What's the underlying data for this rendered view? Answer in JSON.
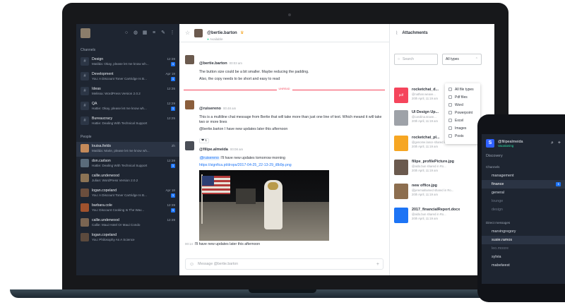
{
  "sidebar": {
    "channels_label": "Channels",
    "people_label": "People",
    "channels": [
      {
        "name": "Design",
        "message": "Matilda: Okay, please let me know wh...",
        "time": "12:39",
        "badge": "1"
      },
      {
        "name": "Development",
        "message": "You: A Discount Toner Cartridge Is B...",
        "time": "Apr 19",
        "badge": "1"
      },
      {
        "name": "Ideas",
        "message": "Melissa: WordPress Version 2.0.2",
        "time": "12:35",
        "badge": ""
      },
      {
        "name": "QA",
        "message": "Hattie: Okay, please let me know wh...",
        "time": "12:29",
        "badge": "1"
      },
      {
        "name": "Bureaucracy",
        "message": "Hattie: Dealing With Technical Support",
        "time": "12:25",
        "badge": ""
      }
    ],
    "people": [
      {
        "name": "louisa.fields",
        "message": "Matilda: Marie, please let me know wh...",
        "time": "2h",
        "badge": "",
        "color": "#c48a5a"
      },
      {
        "name": "don.carlson",
        "message": "Hattie: Dealing With Technical Support",
        "time": "12:39",
        "badge": "1",
        "color": "#5a6b7a"
      },
      {
        "name": "callie.underwood",
        "message": "Julian: WordPress Version 2.0.2",
        "time": "",
        "badge": "",
        "color": "#8b7355"
      },
      {
        "name": "logan.copeland",
        "message": "You: A Discount Toner Cartridge Is B...",
        "time": "Apr 18",
        "badge": "1",
        "color": "#6b4e3d"
      },
      {
        "name": "barbara.cole",
        "message": "You: Discount Cooking Is The Wav...",
        "time": "12:39",
        "badge": "1",
        "color": "#a0522d"
      },
      {
        "name": "callie.underwood",
        "message": "Callie: Maui Hotel Or Maui Condo",
        "time": "12:39",
        "badge": "",
        "color": "#7a6552"
      },
      {
        "name": "logan.copeland",
        "message": "You: Philosophy As A Science",
        "time": "",
        "badge": "",
        "color": "#5c4a3d"
      }
    ]
  },
  "chat": {
    "user": "@bertie.barton",
    "status": "Available",
    "messages": [
      {
        "user": "@bertie.barton",
        "time": "00:03 am",
        "lines": [
          "The button size could be a bit smaller. Maybe reducing the padding.",
          "Also, the copy needs to be short and easy to read"
        ]
      },
      {
        "user": "@ruisereno",
        "time": "00:48 am",
        "lines": [
          "This is a multiline chat message from Bertie that will take more than just one line of text. Which meand it will take two or more lines",
          "@bertie.barton I have new updates later this afternoon"
        ],
        "reaction": "❤ 1"
      },
      {
        "user": "@filipe.almeida",
        "time": "00:08 am",
        "mention": "@ruisereno",
        "mention_text": "I'll have new updates tomorrow morning",
        "link": "https://signfica.pt/drops/2017-04-25_22-13-29_i8b9p.png"
      }
    ],
    "unread_label": "UNREAD",
    "followup_time": "00:14",
    "followup_text": "I'll have new updates later this afternoon",
    "composer_placeholder": "Message @bertie.barton"
  },
  "attachments": {
    "title": "Attachments",
    "search_placeholder": "Search",
    "filter_value": "All types",
    "filter_options": [
      "All file types",
      "Pdf files",
      "Word",
      "Powerpoint",
      "Excel",
      "Images",
      "Posts"
    ],
    "files": [
      {
        "name": "rocketchat_d...",
        "meta": "@nathan.weave...",
        "date": "20th April, 11:19 am",
        "color": "#f5455c",
        "kind": "pdf"
      },
      {
        "name": "UI Design Up...",
        "meta": "@carolina.snave...",
        "date": "20th April, 11:19 am",
        "color": "#9ea2a8",
        "kind": ""
      },
      {
        "name": "rocketchat_pl...",
        "meta": "@genome.lance shared in Ro...",
        "date": "20th April, 11:19 am",
        "color": "#f6a623",
        "kind": ""
      },
      {
        "name": "filipe_profilePicture.jpg",
        "meta": "@aldo.bun shared in Ro...",
        "date": "20th April, 11:19 am",
        "color": "#6b5a4e",
        "kind": ""
      },
      {
        "name": "new office.jpg",
        "meta": "@jeremiahamed shared in Ro...",
        "date": "20th April, 11:19 am",
        "color": "#8d6e4f",
        "kind": ""
      },
      {
        "name": "2017_financialReport.docx",
        "meta": "@aldo.bun shared in Ro...",
        "date": "20th April, 11:19 am",
        "color": "#1d74f5",
        "kind": ""
      }
    ]
  },
  "phone": {
    "user": "@filipealmeida",
    "status": "Vacationing",
    "discovery": "Discovery",
    "channels_label": "Channels",
    "channels": [
      "management",
      "finance",
      "general",
      "lounge",
      "design"
    ],
    "finance_badge": "1",
    "direct_label": "Direct messages",
    "direct": [
      "marvingregory",
      "susie.ramos",
      "leo.moore",
      "sylvia",
      "mabelwest"
    ]
  }
}
